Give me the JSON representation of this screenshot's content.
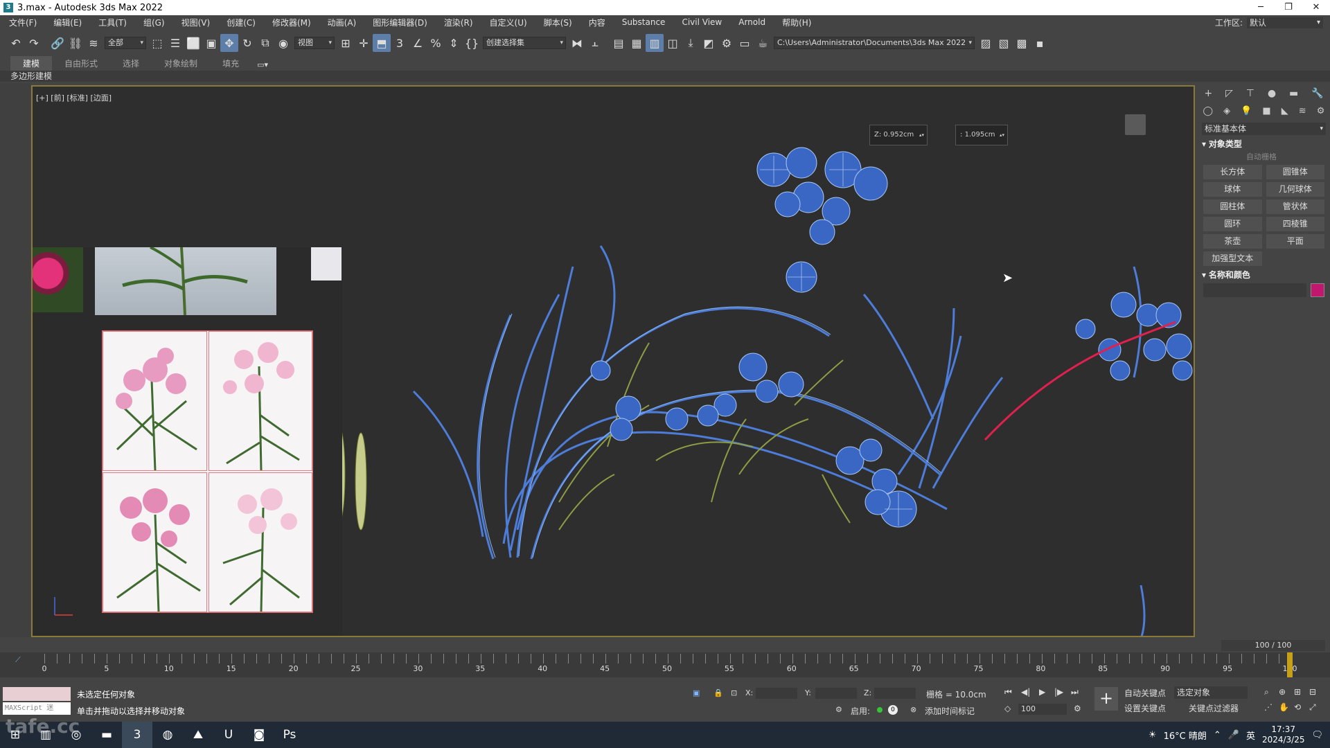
{
  "window": {
    "title": "3.max - Autodesk 3ds Max 2022",
    "app_icon_glyph": "3",
    "minimize": "─",
    "maximize": "❐",
    "close": "✕"
  },
  "menu": {
    "items": [
      "文件(F)",
      "编辑(E)",
      "工具(T)",
      "组(G)",
      "视图(V)",
      "创建(C)",
      "修改器(M)",
      "动画(A)",
      "图形编辑器(D)",
      "渲染(R)",
      "自定义(U)",
      "脚本(S)",
      "内容",
      "Substance",
      "Civil View",
      "Arnold",
      "帮助(H)"
    ],
    "workspace_label": "工作区:",
    "workspace_value": "默认"
  },
  "toolbar": {
    "filter_value": "全部",
    "refcoord_value": "视图",
    "selection_set_placeholder": "创建选择集",
    "project_path": "C:\\Users\\Administrator\\Documents\\3ds Max 2022"
  },
  "ribbon": {
    "tabs": [
      "建模",
      "自由形式",
      "选择",
      "对象绘制",
      "填充"
    ],
    "active_tab": "建模",
    "sub_label": "多边形建模"
  },
  "viewport": {
    "label": "[+] [前] [标准] [边面]",
    "spinner_z_label": "Z:",
    "spinner_z_value": "0.952cm",
    "spinner_2_label": ":",
    "spinner_2_value": "1.095cm"
  },
  "command_panel": {
    "category": "标准基本体",
    "section_object_type": "对象类型",
    "autogrid_label": "自动栅格",
    "buttons": [
      "长方体",
      "圆锥体",
      "球体",
      "几何球体",
      "圆柱体",
      "管状体",
      "圆环",
      "四棱锥",
      "茶壶",
      "平面",
      "加强型文本"
    ],
    "section_name_color": "名称和颜色",
    "object_color": "#c2176e"
  },
  "timeline": {
    "slider_label": "100 / 100",
    "current_frame": 100,
    "ticks": [
      "0",
      "5",
      "10",
      "15",
      "20",
      "25",
      "30",
      "35",
      "40",
      "45",
      "50",
      "55",
      "60",
      "65",
      "70",
      "75",
      "80",
      "85",
      "90",
      "95",
      "100"
    ]
  },
  "status": {
    "maxscript_label": "MAXScript 迷",
    "line1": "未选定任何对象",
    "line2": "单击并拖动以选择并移动对象",
    "x_label": "X:",
    "y_label": "Y:",
    "z_label": "Z:",
    "grid_value": "栅格 = 10.0cm",
    "enable_label": "启用:",
    "add_time_tag": "添加时间标记",
    "auto_key": "自动关键点",
    "set_key": "设置关键点",
    "selected_object": "选定对象",
    "key_filters": "关键点过滤器",
    "frame_value": "100"
  },
  "taskbar": {
    "weather": "16°C 晴朗",
    "ime": "英",
    "time": "17:37",
    "date": "2024/3/25",
    "watermark": "tafe.cc"
  }
}
